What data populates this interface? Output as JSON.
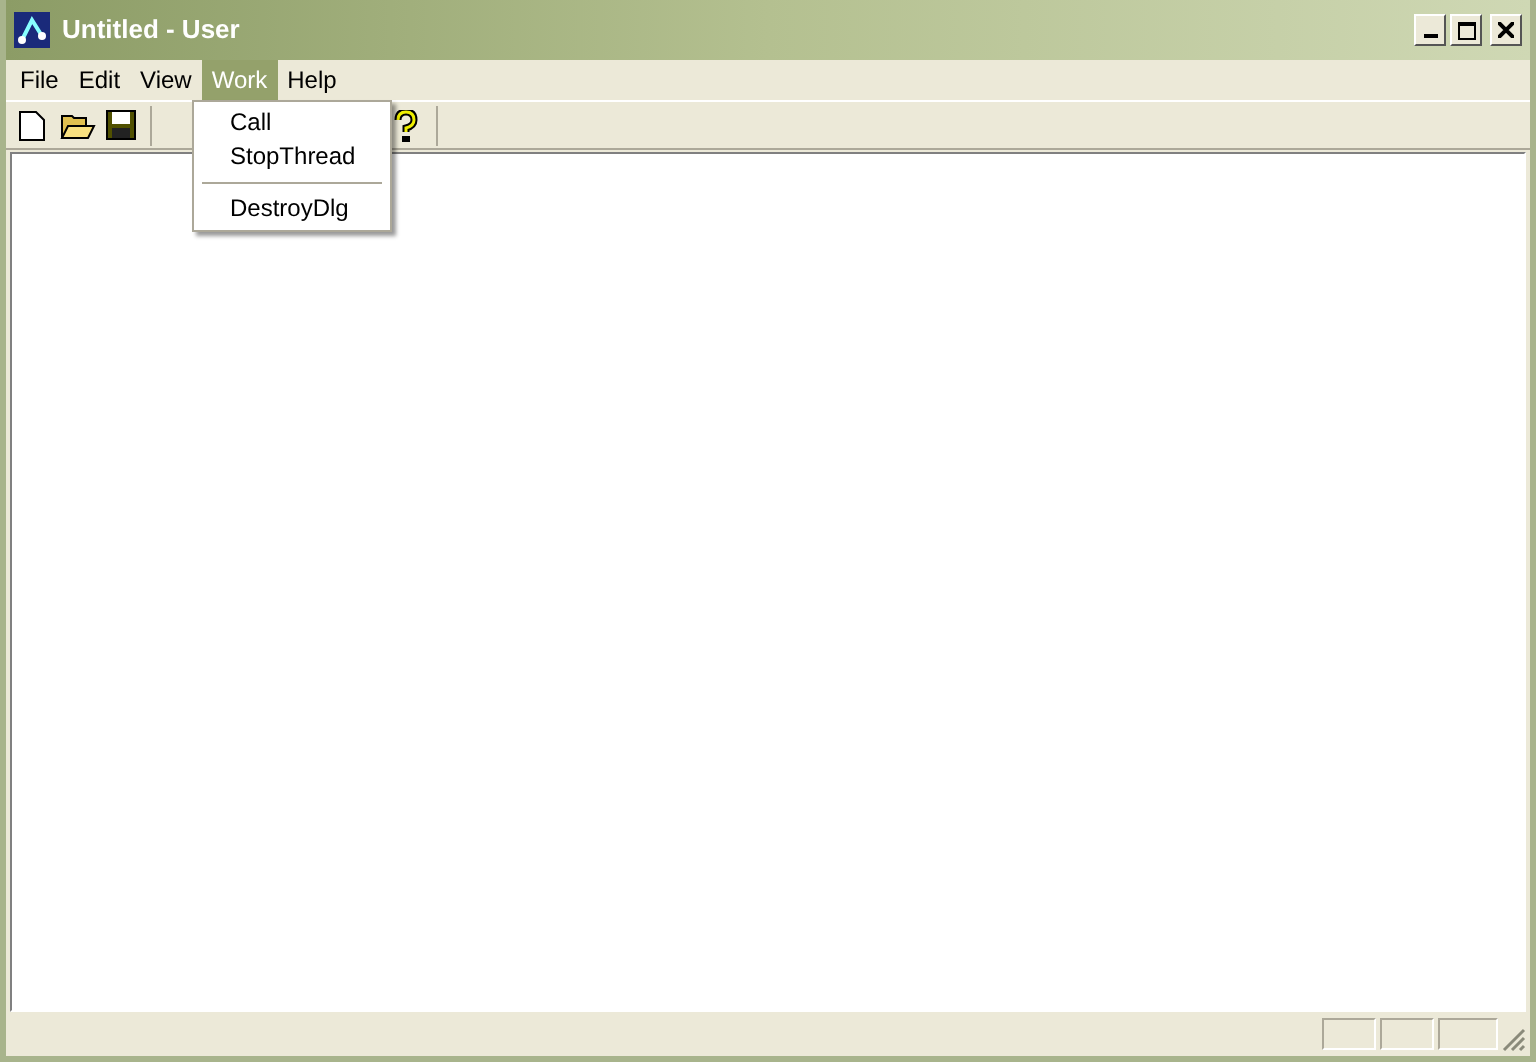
{
  "window": {
    "title": "Untitled - User"
  },
  "menu_bar": [
    {
      "label": "File",
      "selected": false
    },
    {
      "label": "Edit",
      "selected": false
    },
    {
      "label": "View",
      "selected": false
    },
    {
      "label": "Work",
      "selected": true
    },
    {
      "label": "Help",
      "selected": false
    }
  ],
  "open_menu": [
    {
      "kind": "item",
      "label": "Call"
    },
    {
      "kind": "item",
      "label": "StopThread"
    },
    {
      "kind": "separator"
    },
    {
      "kind": "item",
      "label": "DestroyDlg"
    }
  ]
}
